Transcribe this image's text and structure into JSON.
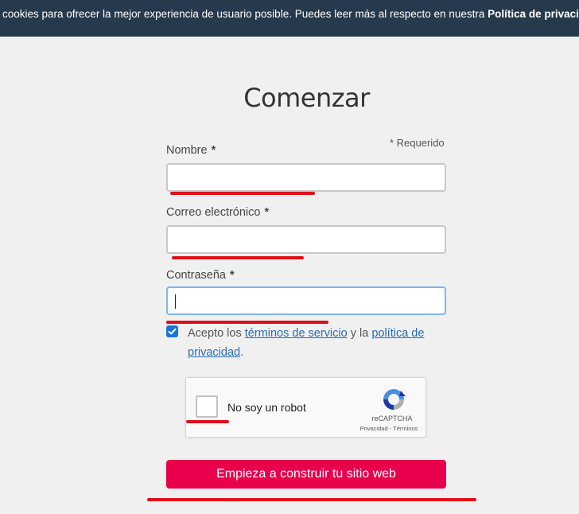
{
  "cookie_bar": {
    "text": "cookies para ofrecer la mejor experiencia de usuario posible. Puedes leer más al respecto en nuestra ",
    "link": "Política de privacidad"
  },
  "form": {
    "title": "Comenzar",
    "required_note": "* Requerido",
    "fields": [
      {
        "label": "Nombre",
        "star": "*",
        "value": ""
      },
      {
        "label": "Correo electrónico",
        "star": "*",
        "value": ""
      },
      {
        "label": "Contraseña",
        "star": "*",
        "value": ""
      }
    ],
    "terms": {
      "checked": true,
      "prefix": "Acepto los ",
      "link1": "términos de servicio",
      "middle": " y la ",
      "link2": "política de privacidad",
      "suffix": "."
    },
    "recaptcha": {
      "label": "No soy un robot",
      "brand": "reCAPTCHA",
      "links": "Privacidad - Términos"
    },
    "submit_label": "Empieza a construir tu sitio web"
  },
  "colors": {
    "cookie_bar_bg": "#26394d",
    "annotation_red": "#e0101a",
    "submit_bg": "#e8004c",
    "link": "#2a6bb0"
  }
}
